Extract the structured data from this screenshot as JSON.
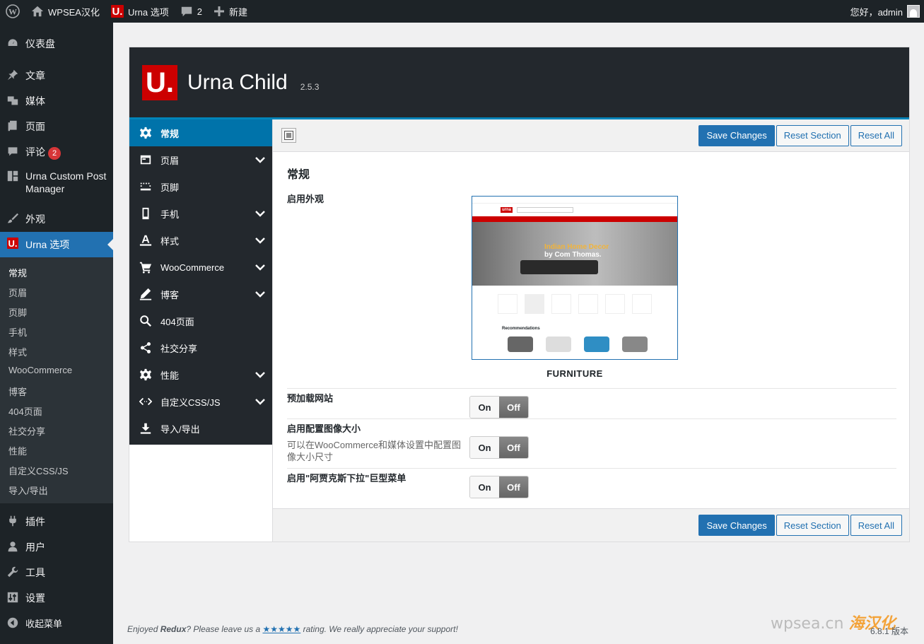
{
  "adminbar": {
    "site_name": "WPSEA汉化",
    "theme_options": "Urna 选项",
    "comments_count": "2",
    "new_label": "新建",
    "greeting": "您好，admin"
  },
  "sidebar": {
    "items": [
      {
        "label": "仪表盘",
        "icon": "dashboard-icon"
      },
      {
        "label": "文章",
        "icon": "pin-icon"
      },
      {
        "label": "媒体",
        "icon": "media-icon"
      },
      {
        "label": "页面",
        "icon": "page-icon"
      },
      {
        "label": "评论",
        "icon": "comment-icon",
        "badge": "2"
      },
      {
        "label": "Urna Custom Post Manager",
        "icon": "grid-icon"
      },
      {
        "label": "外观",
        "icon": "brush-icon"
      },
      {
        "label": "Urna 选项",
        "icon": "urna-logo-icon"
      }
    ],
    "submenu": [
      "常规",
      "页眉",
      "页脚",
      "手机",
      "样式",
      "WooCommerce",
      "博客",
      "404页面",
      "社交分享",
      "性能",
      "自定义CSS/JS",
      "导入/导出"
    ],
    "bottom_items": [
      {
        "label": "插件",
        "icon": "plugin-icon"
      },
      {
        "label": "用户",
        "icon": "user-icon"
      },
      {
        "label": "工具",
        "icon": "wrench-icon"
      },
      {
        "label": "设置",
        "icon": "settings-icon"
      },
      {
        "label": "收起菜单",
        "icon": "collapse-icon"
      }
    ]
  },
  "panel": {
    "logo_letter": "U.",
    "theme_name": "Urna Child",
    "version": "2.5.3",
    "nav": [
      {
        "label": "常规",
        "icon": "gear-icon",
        "active": true
      },
      {
        "label": "页眉",
        "icon": "header-icon",
        "chevron": true
      },
      {
        "label": "页脚",
        "icon": "footer-icon"
      },
      {
        "label": "手机",
        "icon": "mobile-icon",
        "chevron": true
      },
      {
        "label": "样式",
        "icon": "text-style-icon",
        "chevron": true
      },
      {
        "label": "WooCommerce",
        "icon": "cart-icon",
        "chevron": true
      },
      {
        "label": "博客",
        "icon": "pen-icon",
        "chevron": true
      },
      {
        "label": "404页面",
        "icon": "search-404-icon"
      },
      {
        "label": "社交分享",
        "icon": "share-icon"
      },
      {
        "label": "性能",
        "icon": "gear-icon",
        "chevron": true
      },
      {
        "label": "自定义CSS/JS",
        "icon": "code-icon",
        "chevron": true
      },
      {
        "label": "导入/导出",
        "icon": "download-icon"
      }
    ],
    "buttons": {
      "save": "Save Changes",
      "reset_section": "Reset Section",
      "reset_all": "Reset All"
    },
    "section_title": "常规",
    "fields": {
      "skin_label": "启用外观",
      "skin_caption": "FURNITURE",
      "preview_hero_text_1": "Indian Home Decor",
      "preview_hero_text_2": "by Com Thomas.",
      "preview_logo": "urna",
      "preview_recommendations": "Recommendations",
      "preload_label": "预加载网站",
      "image_size_label": "启用配置图像大小",
      "image_size_desc": "可以在WooCommerce和媒体设置中配置图像大小尺寸",
      "mega_menu_label": "启用\"阿贾克斯下拉\"巨型菜单",
      "switch_on": "On",
      "switch_off": "Off"
    }
  },
  "footer": {
    "text_1": "Enjoyed ",
    "redux": "Redux",
    "text_2": "? Please leave us a ",
    "stars": "★★★★★",
    "text_3": " rating. We really appreciate your support!",
    "version": "6.8.1 版本",
    "watermark_1": "wpsea.cn",
    "watermark_2": "海汉化"
  }
}
